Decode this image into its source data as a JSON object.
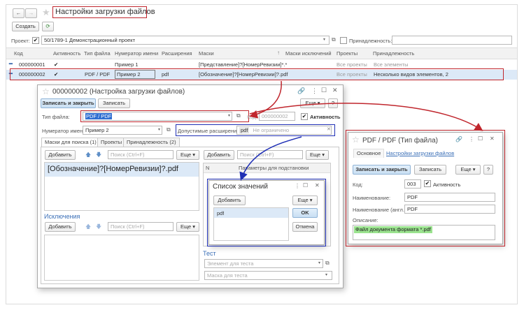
{
  "main": {
    "title": "Настройки загрузки файлов",
    "nav_back": "←",
    "nav_fwd": "→",
    "star": "★",
    "create_label": "Создать",
    "project_label": "Проект:",
    "project_value": "50/1789-1 Демонстрационный проект",
    "belonging_label": "Принадлежность:",
    "columns": [
      "Код",
      "Активность",
      "Тип файла",
      "Нумератор имени",
      "Расширения",
      "Маски",
      "Маски исключений",
      "Проекты",
      "Принадлежность"
    ],
    "rows": [
      {
        "code": "000000001",
        "active": "✔",
        "type": "",
        "numerator": "Пример 1",
        "ext": "",
        "masks": "[Представление]?[НомерРевизии]*.*",
        "excl": "",
        "projects": "Все проекты",
        "belonging": "Все элементы"
      },
      {
        "code": "000000002",
        "active": "✔",
        "type": "PDF / PDF",
        "numerator": "Пример 2",
        "ext": "pdf",
        "masks": "[Обозначение]?[НомерРевизии]?.pdf",
        "excl": "",
        "projects": "Все проекты",
        "belonging": "Несколько видов элементов, 2"
      }
    ]
  },
  "settings_form": {
    "title": "000000002 (Настройка загрузки файлов)",
    "save_close": "Записать и закрыть",
    "save": "Записать",
    "more": "Еще",
    "help": "?",
    "file_type_label": "Тип файла:",
    "file_type_value": "PDF / PDF",
    "code_label": "Код:",
    "code_value": "000000002",
    "active_label": "Активность",
    "numerator_label": "Нумератор имени:",
    "numerator_value": "Пример 2",
    "allowed_ext_label": "Допустимые расширения:",
    "allowed_ext_value": "pdf",
    "allowed_ext_hint": "Не ограничено",
    "tabs": [
      "Маски для поиска (1)",
      "Проекты",
      "Принадлежность (2)"
    ],
    "add_label": "Добавить",
    "search_placeholder": "Поиск (Ctrl+F)",
    "mask_item": "[Обозначение]?[НомерРевизии]?.pdf",
    "exclusions_title": "Исключения",
    "param_col_n": "N",
    "param_col_name": "Параметры для подстановки",
    "test_title": "Тест",
    "test_element_placeholder": "Элемент для теста",
    "test_mask_placeholder": "Маска для теста"
  },
  "value_list": {
    "title": "Список значений",
    "add_label": "Добавить",
    "more": "Еще",
    "item": "pdf",
    "ok": "OK",
    "cancel": "Отмена"
  },
  "file_type_form": {
    "title": "PDF / PDF (Тип файла)",
    "tab_main": "Основное",
    "tab_link": "Настройки загрузки файлов",
    "save_close": "Записать и закрыть",
    "save": "Записать",
    "more": "Еще",
    "help": "?",
    "code_label": "Код:",
    "code_value": "003",
    "active_label": "Активность",
    "name_label": "Наименование:",
    "name_value": "PDF",
    "name_en_label": "Наименование (англ.):",
    "name_en_value": "PDF",
    "desc_label": "Описание:",
    "desc_value": "Файл документа формата *.pdf"
  },
  "colors": {
    "highlight_red": "#c0262d",
    "highlight_blue": "#1f2fb5",
    "selection": "#dce9f7",
    "desc_fill": "#9be38f"
  }
}
